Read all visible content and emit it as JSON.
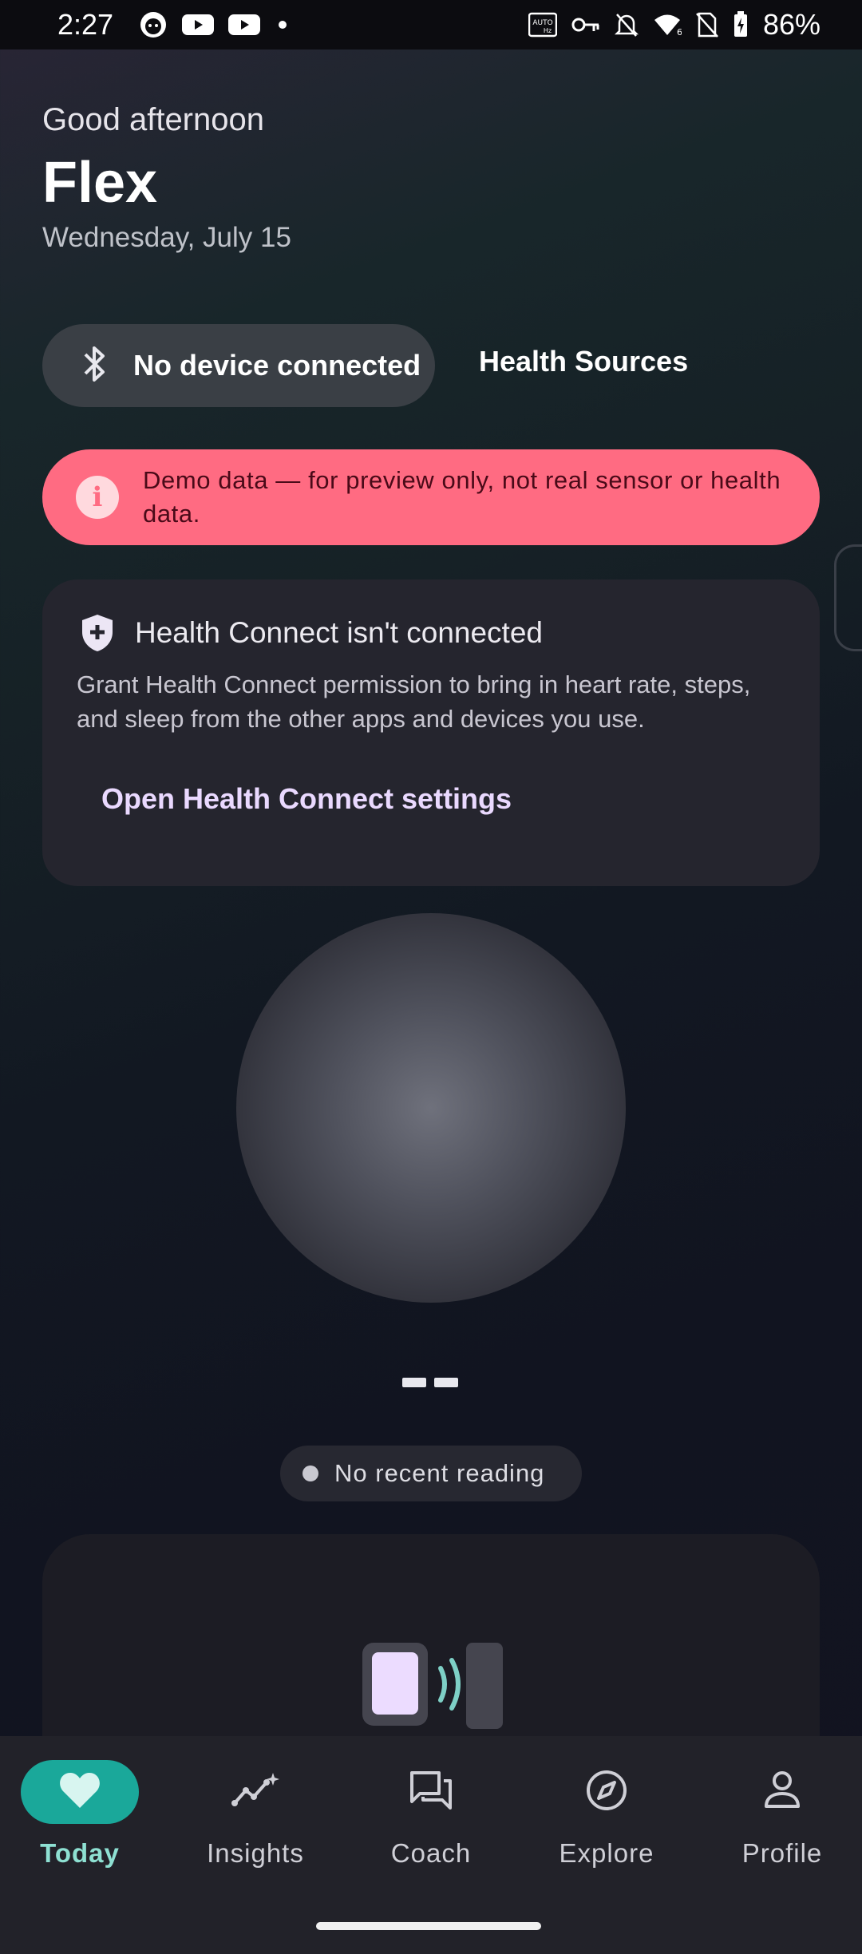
{
  "status_bar": {
    "time": "2:27",
    "battery": "86%",
    "left_icons": [
      "cat-app-icon",
      "youtube-icon",
      "youtube-icon",
      "dot-icon"
    ],
    "right_icons": [
      "auto-hz-icon",
      "vpn-key-icon",
      "bell-off-icon",
      "wifi-icon",
      "no-sim-icon",
      "battery-charging-icon"
    ]
  },
  "header": {
    "greeting": "Good afternoon",
    "name": "Flex",
    "date": "Wednesday, July 15"
  },
  "device": {
    "status_label": "No device connected",
    "icon": "bluetooth-icon",
    "health_sources_label": "Health Sources"
  },
  "demo_banner": {
    "text": "Demo data — for preview only, not real sensor or health data.",
    "icon": "info-icon",
    "color": "#ff6b82"
  },
  "health_connect": {
    "title": "Health Connect isn't connected",
    "description": "Grant Health Connect permission to bring in heart rate, steps, and sleep from the other apps and devices you use.",
    "button_label": "Open Health Connect settings",
    "icon": "shield-plus-icon"
  },
  "reading": {
    "value_placeholder": "--",
    "status_label": "No recent reading"
  },
  "bottom_nav": {
    "accent": "#1aa89a",
    "items": [
      {
        "label": "Today",
        "icon": "heart-icon",
        "active": true
      },
      {
        "label": "Insights",
        "icon": "sparkle-chart-icon",
        "active": false
      },
      {
        "label": "Coach",
        "icon": "chat-bubbles-icon",
        "active": false
      },
      {
        "label": "Explore",
        "icon": "compass-icon",
        "active": false
      },
      {
        "label": "Profile",
        "icon": "person-icon",
        "active": false
      }
    ]
  }
}
